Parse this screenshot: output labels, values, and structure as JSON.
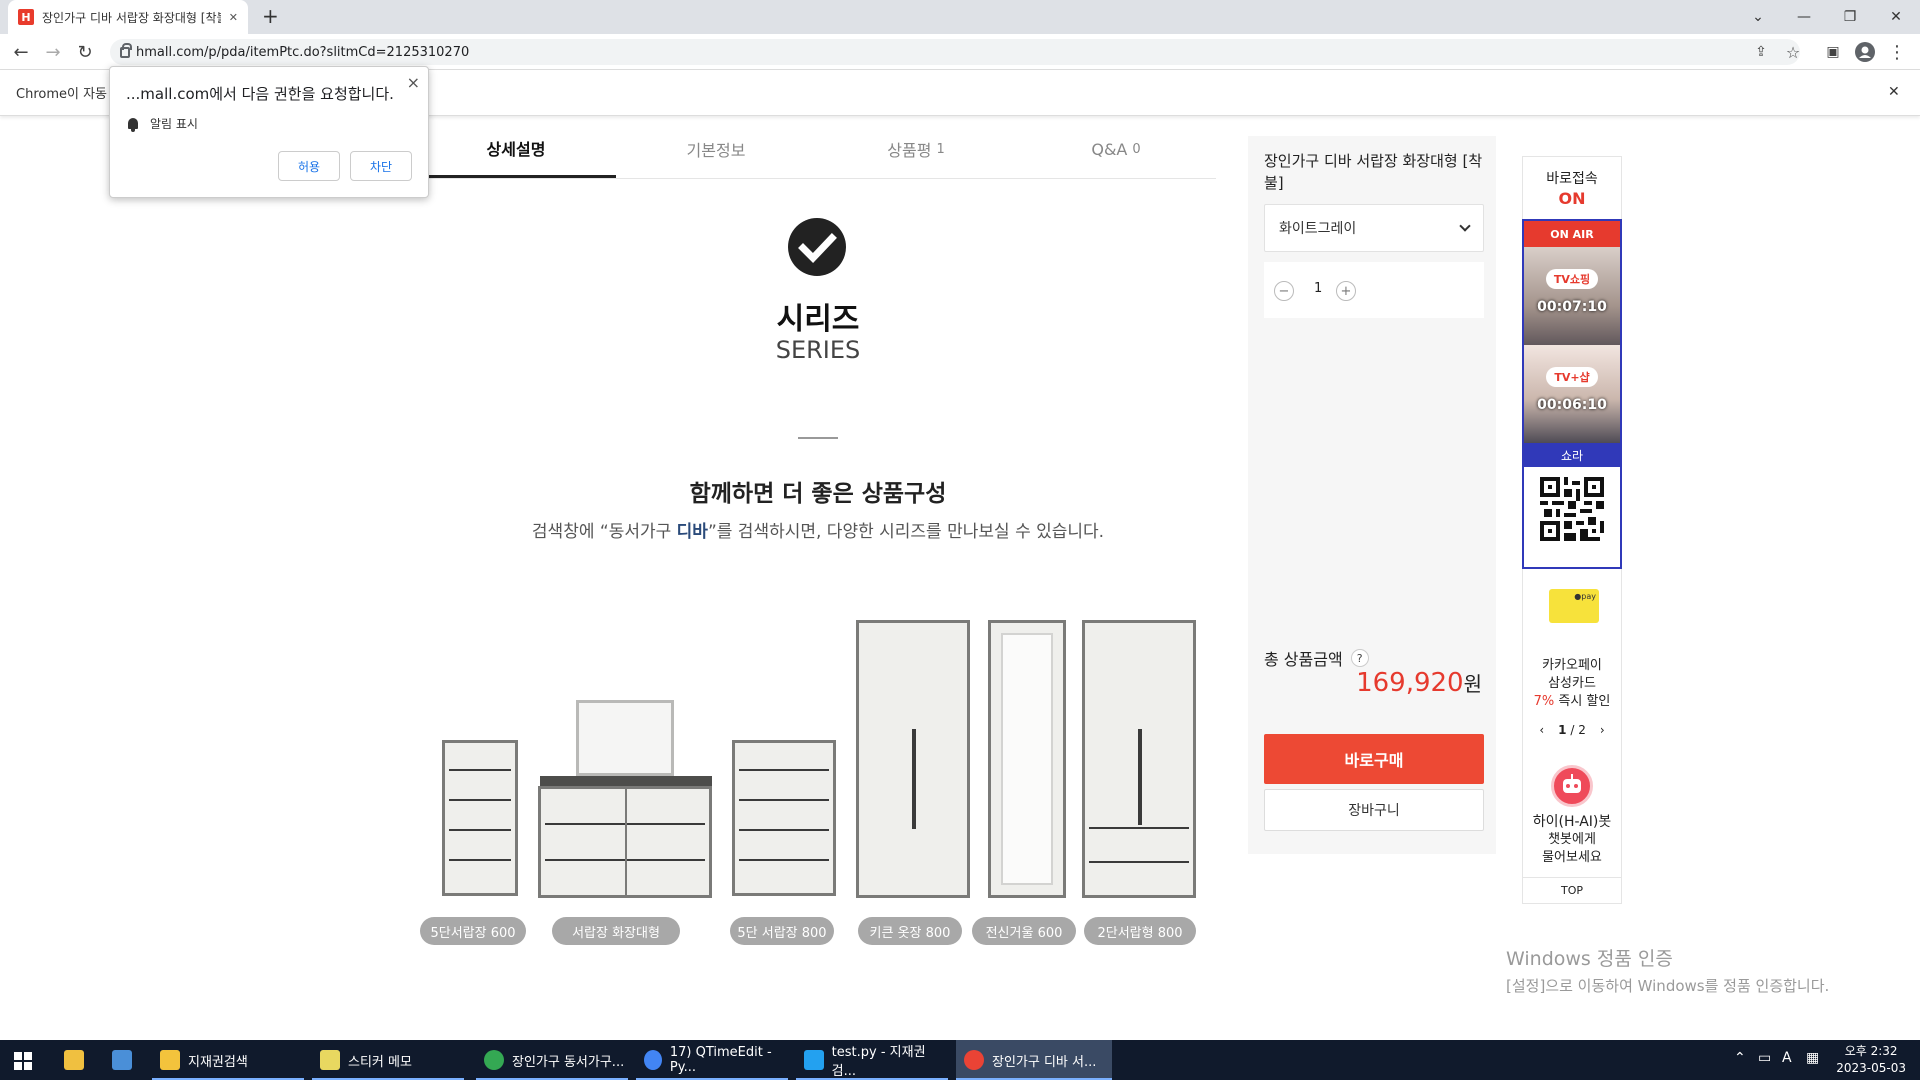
{
  "browser": {
    "tab_title": "장인가구 디바 서랍장 화장대형 [착불]",
    "tab_favicon": "H",
    "url": "hmall.com/p/pda/itemPtc.do?slitmCd=2125310270",
    "infobar_text": "Chrome이 자동",
    "new_tab": "+",
    "win_icons": {
      "menu": "⌄",
      "min": "—",
      "max": "❐",
      "close": "✕",
      "infobar_close": "✕"
    }
  },
  "permission_popup": {
    "title": "...mall.com에서 다음 권한을 요청합니다.",
    "item": "알림 표시",
    "allow": "허용",
    "block": "차단",
    "close": "×"
  },
  "tabs": [
    {
      "label": "상세설명",
      "count": ""
    },
    {
      "label": "기본정보",
      "count": ""
    },
    {
      "label": "상품평",
      "count": "1"
    },
    {
      "label": "Q&A",
      "count": "0"
    }
  ],
  "content": {
    "series_title": "시리즈",
    "series_sub": "SERIES",
    "combo_title": "함께하면 더 좋은 상품구성",
    "combo_desc_pre": "검색창에 “동서가구 ",
    "combo_desc_hl": "디바",
    "combo_desc_post": "”를 검색하시면, 다양한 시리즈를 만나보실 수 있습니다.",
    "items": [
      "5단서랍장 600",
      "서랍장 화장대형",
      "5단 서랍장 800",
      "키큰 옷장 800",
      "전신거울 600",
      "2단서랍형 800"
    ]
  },
  "panel": {
    "product_name": "장인가구 디바 서랍장 화장대형 [착불]",
    "option": "화이트그레이",
    "qty": "1",
    "minus": "−",
    "plus": "+",
    "total_label": "총 상품금액",
    "help": "?",
    "price": "169,920",
    "won": "원",
    "buy": "바로구매",
    "cart": "장바구니"
  },
  "quick": {
    "title": "바로접속",
    "on": "ON",
    "onair": "ON AIR",
    "tv_badge": "TV쇼핑",
    "tv_time": "00:07:10",
    "tvplus_badge": "TV+샵",
    "tvplus_time": "00:06:10",
    "shora": "쇼라",
    "kpay": "●pay",
    "card_line1": "카카오페이",
    "card_line2": "삼성카드",
    "card_pct": "7%",
    "card_rest": " 즉시 할인",
    "page_prev": "‹",
    "page_cur": "1",
    "page_total": "/ 2",
    "page_next": "›",
    "bot_line1": "하이(H-AI)봇",
    "bot_line2": "챗봇에게",
    "bot_line3": "물어보세요",
    "top": "TOP"
  },
  "watermark": {
    "line1": "Windows 정품 인증",
    "line2": "[설정]으로 이동하여 Windows를 정품 인증합니다."
  },
  "taskbar": {
    "items": [
      "지재권검색",
      "스티커 메모",
      "장인가구 동서가구...",
      "17) QTimeEdit - Py...",
      "test.py - 지재권검...",
      "장인가구 디바 서..."
    ],
    "tray_text": "A",
    "time": "오후 2:32",
    "date": "2023-05-03"
  },
  "colors": {
    "accent": "#ed4934",
    "price": "#e63a2e",
    "navy": "#3039b9",
    "taskbar": "#101a2c"
  }
}
